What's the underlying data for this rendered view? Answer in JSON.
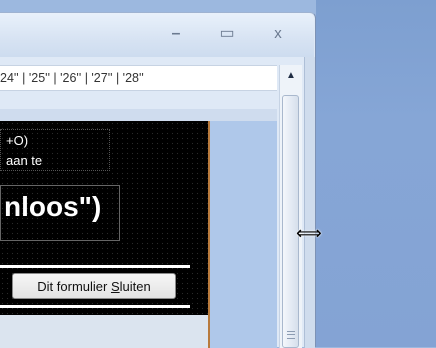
{
  "window": {
    "titlebar_buttons": {
      "minimize": "–",
      "maximize": "▭",
      "close": "x"
    }
  },
  "ruler": {
    "ticks": [
      "24'",
      " ' | ' ",
      "25'",
      " ' | ' ",
      "26'",
      " ' | ' ",
      "27'",
      " ' | ' ",
      "28'",
      " '"
    ]
  },
  "form": {
    "line1": "+O)",
    "line2": "aan te",
    "big_text": "nloos\")",
    "close_button": {
      "text": "Dit formulier ",
      "underlined": "S",
      "rest": "luiten"
    }
  },
  "scrollbar": {
    "up_icon": "▲"
  },
  "cursor": {
    "icon": "⟺"
  }
}
